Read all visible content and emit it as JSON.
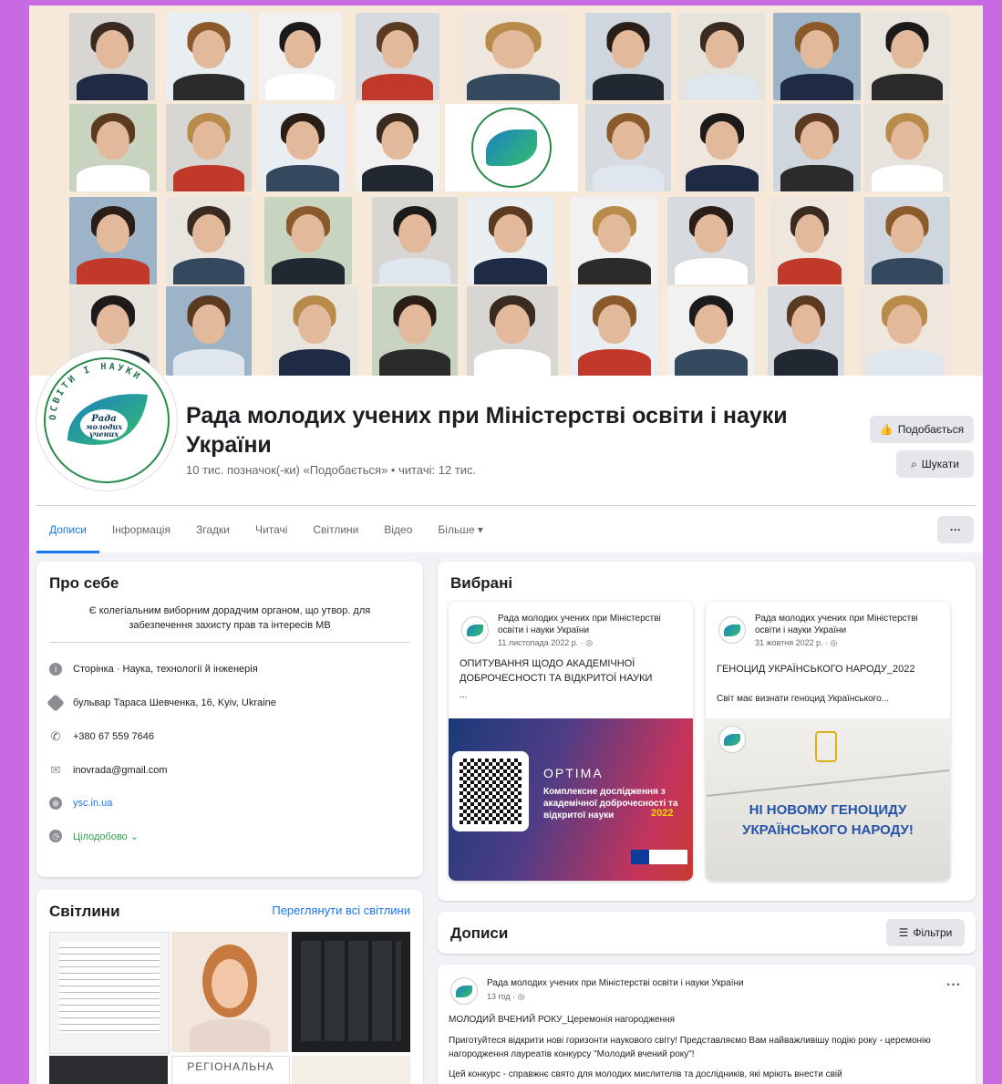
{
  "page": {
    "title": "Рада молодих учених при Міністерстві освіти і науки України",
    "stats": "10 тис. позначок(-ки) «Подобається» • читачі: 12 тис.",
    "like_button": "Подобається",
    "search_button": "Шукати",
    "more_button": "···"
  },
  "logo": {
    "ring_text": "ОСВІТИ І НАУКИ",
    "leaf_text": "Рада молодих учених"
  },
  "tabs": [
    {
      "label": "Дописи"
    },
    {
      "label": "Інформація"
    },
    {
      "label": "Згадки"
    },
    {
      "label": "Читачі"
    },
    {
      "label": "Світлини"
    },
    {
      "label": "Відео"
    },
    {
      "label": "Більше ▾"
    }
  ],
  "about": {
    "heading": "Про себе",
    "description": "Є колегіальним виборним дорадчим органом, що утвор. для забезпечення захисту прав та інтересів МВ",
    "category": "Сторінка · Наука, технології й інженерія",
    "address": "бульвар Тараса Шевченка, 16, Kyiv, Ukraine",
    "phone": "+380 67 559 7646",
    "email": "inovrada@gmail.com",
    "website": "ysc.in.ua",
    "hours": "Цілодобово ⌄"
  },
  "photos": {
    "heading": "Світлини",
    "see_all": "Переглянути всі світлини",
    "tile_caption": "РЕГІОНАЛЬНА"
  },
  "featured": {
    "heading": "Вибрані",
    "items": [
      {
        "author": "Рада молодих учених при Міністерстві освіти і науки України",
        "date": "11 листопада 2022 р. · ◎",
        "title": "ОПИТУВАННЯ ЩОДО АКАДЕМІЧНОЇ ДОБРОЧЕСНОСТІ ТА ВІДКРИТОЇ НАУКИ",
        "ellipsis": "...",
        "image_brand": "OPTIMA",
        "image_text": "Комплексне дослідження з академічної доброчесності та відкритої науки",
        "image_year": "2022"
      },
      {
        "author": "Рада молодих учених при Міністерстві освіти і науки України",
        "date": "31 жовтня 2022 р. · ◎",
        "title": "ГЕНОЦИД УКРАЇНСЬКОГО НАРОДУ_2022",
        "snippet": "Світ має визнати геноцид Українського...",
        "image_text": "НІ НОВОМУ ГЕНОЦИДУ УКРАЇНСЬКОГО НАРОДУ!"
      }
    ]
  },
  "posts": {
    "heading": "Дописи",
    "filter_button": "Фільтри",
    "post": {
      "author": "Рада молодих учених при Міністерстві освіти і науки України",
      "time": "13 год · ◎",
      "title": "МОЛОДИЙ ВЧЕНИЙ РОКУ_Церемонія нагородження",
      "text1": "Приготуйтеся відкрити нові горизонти наукового світу! Представляємо Вам найважливішу подію року - церемонію нагородження лауреатів конкурсу \"Молодий вчений року\"!",
      "text2": "Цей конкурс - справжнє свято для молодих мислителів та дослідників, які мріють внести свій"
    }
  },
  "colors": {
    "accent": "#1877f2",
    "border_bg": "#c86be2",
    "cover_bg": "#f7e9d9"
  }
}
